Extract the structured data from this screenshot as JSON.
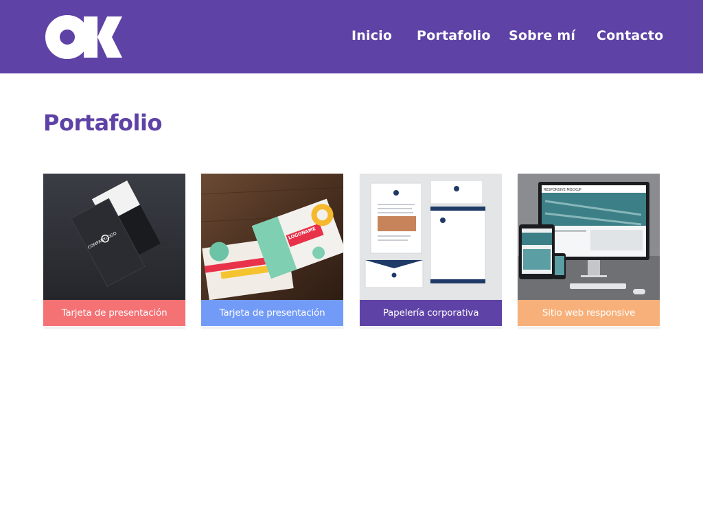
{
  "header": {
    "logo_text": "OK",
    "background": "#5e42a6",
    "nav": [
      {
        "label": "Inicio"
      },
      {
        "label": "Portafolio"
      },
      {
        "label": "Sobre mí"
      },
      {
        "label": "Contacto"
      }
    ]
  },
  "main": {
    "title": "Portafolio",
    "title_color": "#5e42a6",
    "items": [
      {
        "caption": "Tarjeta de presentación",
        "color": "#f47174",
        "image": "dark-business-cards",
        "card_text": "COMPANYLOGO"
      },
      {
        "caption": "Tarjeta de presentación",
        "color": "#729bf7",
        "image": "colorful-business-cards-on-wood",
        "card_text": "LOGONAME"
      },
      {
        "caption": "Papelería corporativa",
        "color": "#5e42a6",
        "image": "corporate-stationery-mockup"
      },
      {
        "caption": "Sitio web responsive",
        "color": "#f8b07a",
        "image": "responsive-devices-mockup",
        "card_text": "RESPONSIVE MOCKUP"
      }
    ]
  }
}
